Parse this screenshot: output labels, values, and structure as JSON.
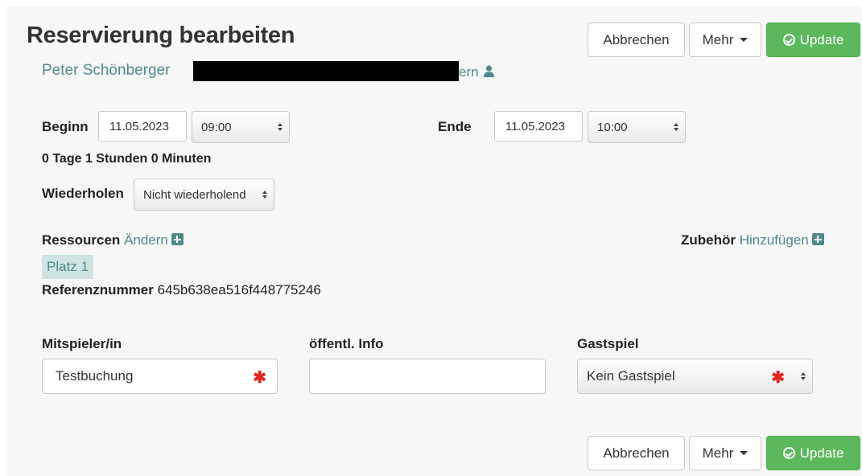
{
  "header": {
    "title": "Reservierung bearbeiten",
    "owner_name": "Peter Schönberger",
    "owner_tail": "ern",
    "icons": {
      "owner": "user-icon"
    }
  },
  "toolbar": {
    "cancel_label": "Abbrechen",
    "more_label": "Mehr",
    "update_label": "Update"
  },
  "time": {
    "begin_label": "Beginn",
    "begin_date": "11.05.2023",
    "begin_time": "09:00",
    "end_label": "Ende",
    "end_date": "11.05.2023",
    "end_time": "10:00",
    "duration": "0 Tage 1 Stunden 0 Minuten"
  },
  "repeat": {
    "label": "Wiederholen",
    "value": "Nicht wiederholend"
  },
  "resources": {
    "label": "Ressourcen",
    "change_link": "Ändern",
    "items": [
      "Platz 1"
    ]
  },
  "accessories": {
    "label": "Zubehör",
    "add_link": "Hinzufügen"
  },
  "reference": {
    "label": "Referenznummer",
    "value": "645b638ea516f448775246"
  },
  "fields": {
    "partner_label": "Mitspieler/in",
    "partner_value": "Testbuchung",
    "info_label": "öffentl. Info",
    "info_value": "",
    "guest_label": "Gastspiel",
    "guest_value": "Kein Gastspiel",
    "required_mark": "✱"
  },
  "colors": {
    "accent": "#4f8a8b",
    "success": "#5cb85c",
    "required": "#e0261f",
    "tag_bg": "#cfe3e3"
  }
}
